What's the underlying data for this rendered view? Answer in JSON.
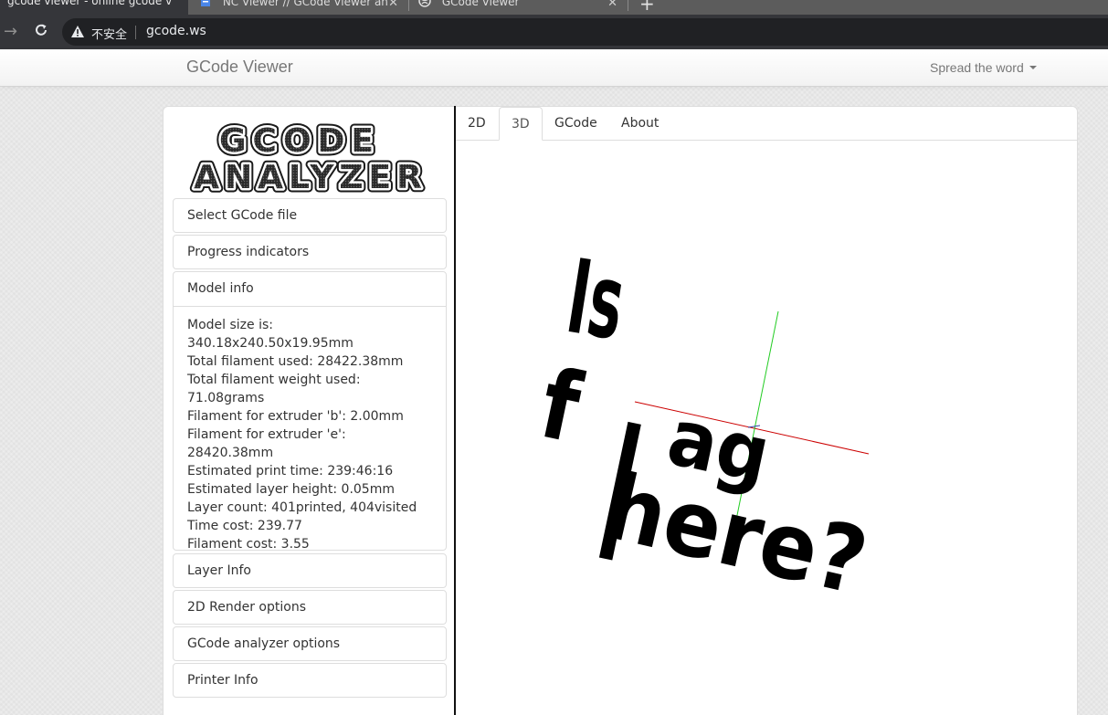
{
  "browser": {
    "tabs": [
      {
        "title": "gcode viewer - online gcode v",
        "active": true
      },
      {
        "title": "NC Viewer // GCode Viewer an",
        "active": false
      },
      {
        "title": "GCode Viewer",
        "active": false
      }
    ],
    "security_label": "不安全",
    "url": "gcode.ws"
  },
  "navbar": {
    "brand": "GCode Viewer",
    "spread_label": "Spread the word"
  },
  "logo": {
    "line1": "GCODE",
    "line2": "ANALYZER"
  },
  "sidebar": {
    "panels": [
      {
        "label": "Select GCode file"
      },
      {
        "label": "Progress indicators"
      },
      {
        "label": "Model info"
      },
      {
        "label": "Layer Info"
      },
      {
        "label": "2D Render options"
      },
      {
        "label": "GCode analyzer options"
      },
      {
        "label": "Printer Info"
      }
    ],
    "model_info_lines": [
      "Model size is:",
      "340.18x240.50x19.95mm",
      "Total filament used: 28422.38mm",
      "Total filament weight used:",
      "71.08grams",
      "Filament for extruder 'b': 2.00mm",
      "Filament for extruder 'e': 28420.38mm",
      "Estimated print time: 239:46:16",
      "Estimated layer height: 0.05mm",
      "Layer count: 401printed, 404visited",
      "Time cost: 239.77",
      "Filament cost: 3.55"
    ]
  },
  "content": {
    "tabs": [
      {
        "label": "2D"
      },
      {
        "label": "3D",
        "active": true
      },
      {
        "label": "GCode"
      },
      {
        "label": "About"
      }
    ],
    "model_text": [
      "Is",
      "f",
      "l",
      "ag",
      "here?"
    ]
  },
  "colors": {
    "axis_x": "#cc0000",
    "axis_y": "#00cc00",
    "model": "#000000"
  }
}
